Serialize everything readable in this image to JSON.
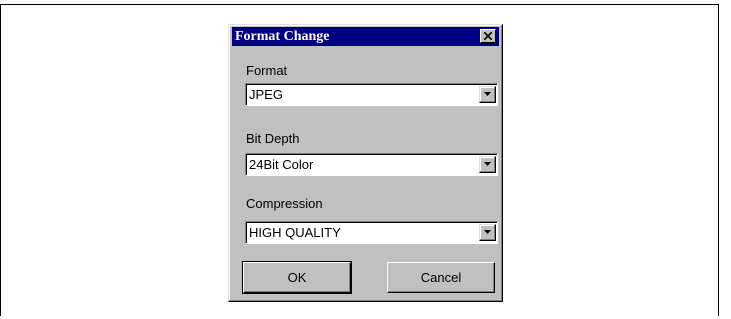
{
  "dialog": {
    "title": "Format Change",
    "close_icon": "close-icon"
  },
  "fields": {
    "format": {
      "label": "Format",
      "value": "JPEG"
    },
    "bit_depth": {
      "label": "Bit Depth",
      "value": "24Bit Color"
    },
    "compression": {
      "label": "Compression",
      "value": "HIGH QUALITY"
    }
  },
  "buttons": {
    "ok": "OK",
    "cancel": "Cancel"
  },
  "colors": {
    "titlebar": "#000080",
    "dialog_face": "#c0c0c0"
  }
}
